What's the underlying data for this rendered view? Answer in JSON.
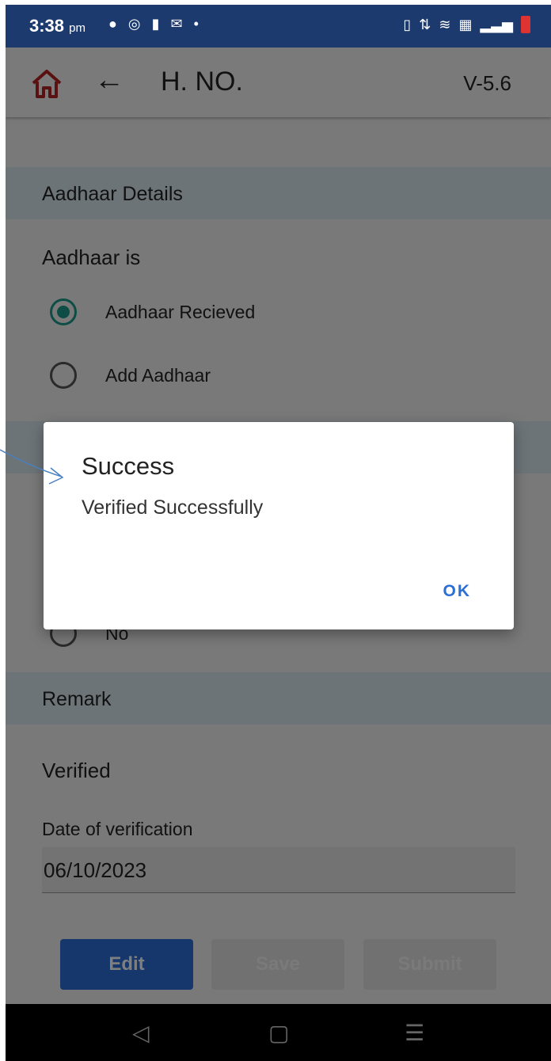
{
  "status_bar": {
    "time": "3:38",
    "ampm": "pm"
  },
  "app_bar": {
    "title": "H. NO.",
    "version": "V-5.6"
  },
  "aadhaar": {
    "section_title": "Aadhaar Details",
    "question": "Aadhaar is",
    "options": [
      {
        "label": "Aadhaar Recieved",
        "selected": true
      },
      {
        "label": "Add Aadhaar",
        "selected": false
      }
    ]
  },
  "hidden_option": {
    "label": "No"
  },
  "remark": {
    "section_title": "Remark",
    "value": "Verified"
  },
  "verification": {
    "date_label": "Date of verification",
    "date_value": "06/10/2023"
  },
  "buttons": {
    "edit": "Edit",
    "save": "Save",
    "submit": "Submit"
  },
  "dialog": {
    "title": "Success",
    "message": "Verified Successfully",
    "ok": "OK"
  },
  "colors": {
    "status_bar": "#1c3a6e",
    "accent": "#2b6fd6",
    "radio_selected": "#1a9a8a",
    "section_header": "#dbe8f1",
    "home_icon": "#b22222"
  }
}
